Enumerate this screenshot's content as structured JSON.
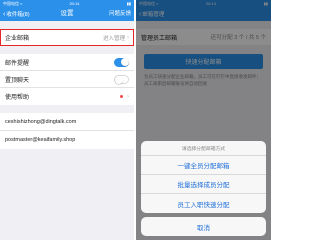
{
  "left": {
    "status": {
      "carrier": "中国电信 ≈",
      "time": "20:14",
      "battery": "▮▮"
    },
    "nav": {
      "back_label": "收件箱(8)",
      "title": "设置",
      "right_label": "问题反馈"
    },
    "settings": {
      "enterprise_label": "企业邮箱",
      "enterprise_value": "进入管理",
      "mail_notify_label": "邮件提醒",
      "mail_notify_on": true,
      "pin_chat_label": "置顶聊天",
      "pin_chat_on": false,
      "help_label": "使用帮助"
    },
    "accounts": [
      "ceshishizhong@dingtalk.com",
      "postmaster@keaifamily.shop"
    ]
  },
  "right": {
    "status": {
      "carrier": "中国电信 ≈",
      "time": "20:14",
      "battery": "▮▮"
    },
    "nav": {
      "back_label": "邮箱管理"
    },
    "manager": {
      "label": "管理员工邮箱",
      "note": "还可分配 3 个 / 共 5 个"
    },
    "quick_button": "快速分配邮箱",
    "desc": "为员工快速分配企业邮箱，员工可在钉钉中直接收发邮件；员工离职后邮箱账号将自动回收",
    "sheet": {
      "title": "请选择分配邮箱方式",
      "options": [
        "一键全员分配邮箱",
        "批量选择成员分配",
        "员工入职快速分配"
      ],
      "cancel": "取消"
    }
  },
  "colors": {
    "primary": "#2b90ea",
    "highlight": "#e52626",
    "action": "#1e6fd9"
  }
}
